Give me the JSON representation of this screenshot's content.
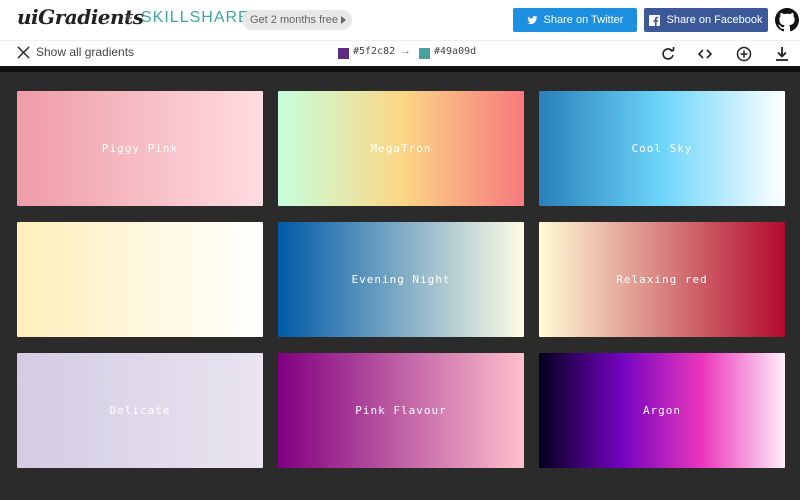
{
  "header": {
    "logo": "uiGradients",
    "plus": "+",
    "partner": "SKILLSHARE",
    "promo": "Get 2 months free",
    "twitter_label": "Share on Twitter",
    "facebook_label": "Share on Facebook"
  },
  "toolbar": {
    "show_all": "Show all gradients",
    "color_from": "#5f2c82",
    "color_to": "#49a09d",
    "arrow": "→"
  },
  "colors": {
    "twitter": "#1d8fe0",
    "facebook": "#3b5998",
    "skillshare": "#3ea6a0",
    "background": "#2b2b2b"
  },
  "gradients": [
    {
      "name": "Piggy Pink",
      "colors": [
        "#ee9ca7",
        "#ffdde1"
      ]
    },
    {
      "name": "MegaTron",
      "colors": [
        "#c6ffdd",
        "#fbd786",
        "#f7797d"
      ]
    },
    {
      "name": "Cool Sky",
      "colors": [
        "#2980b9",
        "#6dd5fa",
        "#ffffff"
      ]
    },
    {
      "name": "",
      "colors": [
        "#ffefba",
        "#ffffff"
      ]
    },
    {
      "name": "Evening Night",
      "colors": [
        "#005aa7",
        "#fffde4"
      ]
    },
    {
      "name": "Relaxing red",
      "colors": [
        "#fffbd5",
        "#b20a2c"
      ]
    },
    {
      "name": "Delicate",
      "colors": [
        "#d3cce3",
        "#e9e4f0"
      ]
    },
    {
      "name": "Pink Flavour",
      "colors": [
        "#800080",
        "#ffc0cb"
      ]
    },
    {
      "name": "Argon",
      "colors": [
        "#03001e",
        "#7303c0",
        "#ec38bc",
        "#fdeff9"
      ]
    }
  ]
}
